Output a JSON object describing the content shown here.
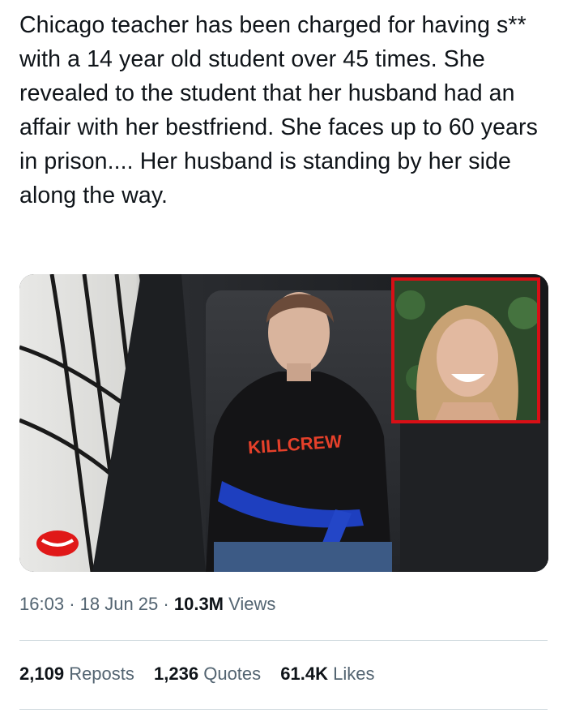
{
  "tweet": {
    "text": "Chicago teacher has been charged for having s** with a 14 year old student over 45 times. She revealed to the student that her husband had an affair with her bestfriend. She faces up to 60 years in prison.... Her husband is standing by her side along the way."
  },
  "media": {
    "hoodie_text": "KILLCREW",
    "inset_border_color": "#d80f16"
  },
  "meta": {
    "time": "16:03",
    "separator": "·",
    "date": "18 Jun 25",
    "views_count": "10.3M",
    "views_label": "Views"
  },
  "stats": {
    "reposts_count": "2,109",
    "reposts_label": "Reposts",
    "quotes_count": "1,236",
    "quotes_label": "Quotes",
    "likes_count": "61.4K",
    "likes_label": "Likes"
  },
  "colors": {
    "text_primary": "#0f1419",
    "text_secondary": "#536471",
    "divider": "#cfd9de"
  }
}
